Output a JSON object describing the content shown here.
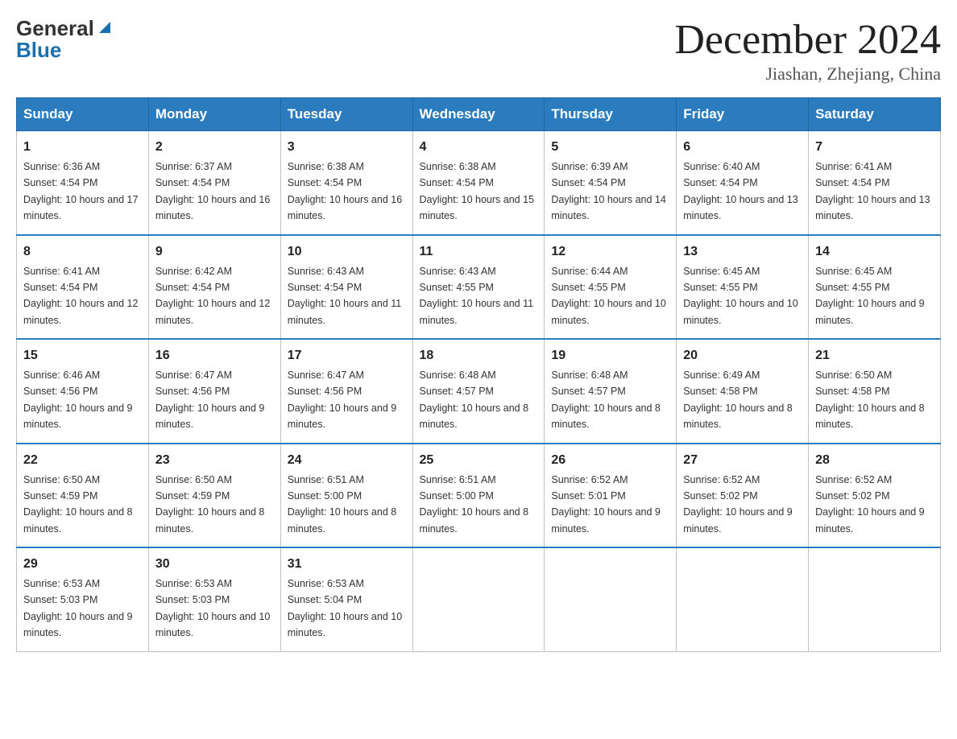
{
  "header": {
    "logo_line1": "General",
    "logo_triangle": "▶",
    "logo_line2": "Blue",
    "title": "December 2024",
    "subtitle": "Jiashan, Zhejiang, China"
  },
  "weekdays": [
    "Sunday",
    "Monday",
    "Tuesday",
    "Wednesday",
    "Thursday",
    "Friday",
    "Saturday"
  ],
  "weeks": [
    [
      {
        "day": "1",
        "sunrise": "6:36 AM",
        "sunset": "4:54 PM",
        "daylight": "10 hours and 17 minutes."
      },
      {
        "day": "2",
        "sunrise": "6:37 AM",
        "sunset": "4:54 PM",
        "daylight": "10 hours and 16 minutes."
      },
      {
        "day": "3",
        "sunrise": "6:38 AM",
        "sunset": "4:54 PM",
        "daylight": "10 hours and 16 minutes."
      },
      {
        "day": "4",
        "sunrise": "6:38 AM",
        "sunset": "4:54 PM",
        "daylight": "10 hours and 15 minutes."
      },
      {
        "day": "5",
        "sunrise": "6:39 AM",
        "sunset": "4:54 PM",
        "daylight": "10 hours and 14 minutes."
      },
      {
        "day": "6",
        "sunrise": "6:40 AM",
        "sunset": "4:54 PM",
        "daylight": "10 hours and 13 minutes."
      },
      {
        "day": "7",
        "sunrise": "6:41 AM",
        "sunset": "4:54 PM",
        "daylight": "10 hours and 13 minutes."
      }
    ],
    [
      {
        "day": "8",
        "sunrise": "6:41 AM",
        "sunset": "4:54 PM",
        "daylight": "10 hours and 12 minutes."
      },
      {
        "day": "9",
        "sunrise": "6:42 AM",
        "sunset": "4:54 PM",
        "daylight": "10 hours and 12 minutes."
      },
      {
        "day": "10",
        "sunrise": "6:43 AM",
        "sunset": "4:54 PM",
        "daylight": "10 hours and 11 minutes."
      },
      {
        "day": "11",
        "sunrise": "6:43 AM",
        "sunset": "4:55 PM",
        "daylight": "10 hours and 11 minutes."
      },
      {
        "day": "12",
        "sunrise": "6:44 AM",
        "sunset": "4:55 PM",
        "daylight": "10 hours and 10 minutes."
      },
      {
        "day": "13",
        "sunrise": "6:45 AM",
        "sunset": "4:55 PM",
        "daylight": "10 hours and 10 minutes."
      },
      {
        "day": "14",
        "sunrise": "6:45 AM",
        "sunset": "4:55 PM",
        "daylight": "10 hours and 9 minutes."
      }
    ],
    [
      {
        "day": "15",
        "sunrise": "6:46 AM",
        "sunset": "4:56 PM",
        "daylight": "10 hours and 9 minutes."
      },
      {
        "day": "16",
        "sunrise": "6:47 AM",
        "sunset": "4:56 PM",
        "daylight": "10 hours and 9 minutes."
      },
      {
        "day": "17",
        "sunrise": "6:47 AM",
        "sunset": "4:56 PM",
        "daylight": "10 hours and 9 minutes."
      },
      {
        "day": "18",
        "sunrise": "6:48 AM",
        "sunset": "4:57 PM",
        "daylight": "10 hours and 8 minutes."
      },
      {
        "day": "19",
        "sunrise": "6:48 AM",
        "sunset": "4:57 PM",
        "daylight": "10 hours and 8 minutes."
      },
      {
        "day": "20",
        "sunrise": "6:49 AM",
        "sunset": "4:58 PM",
        "daylight": "10 hours and 8 minutes."
      },
      {
        "day": "21",
        "sunrise": "6:50 AM",
        "sunset": "4:58 PM",
        "daylight": "10 hours and 8 minutes."
      }
    ],
    [
      {
        "day": "22",
        "sunrise": "6:50 AM",
        "sunset": "4:59 PM",
        "daylight": "10 hours and 8 minutes."
      },
      {
        "day": "23",
        "sunrise": "6:50 AM",
        "sunset": "4:59 PM",
        "daylight": "10 hours and 8 minutes."
      },
      {
        "day": "24",
        "sunrise": "6:51 AM",
        "sunset": "5:00 PM",
        "daylight": "10 hours and 8 minutes."
      },
      {
        "day": "25",
        "sunrise": "6:51 AM",
        "sunset": "5:00 PM",
        "daylight": "10 hours and 8 minutes."
      },
      {
        "day": "26",
        "sunrise": "6:52 AM",
        "sunset": "5:01 PM",
        "daylight": "10 hours and 9 minutes."
      },
      {
        "day": "27",
        "sunrise": "6:52 AM",
        "sunset": "5:02 PM",
        "daylight": "10 hours and 9 minutes."
      },
      {
        "day": "28",
        "sunrise": "6:52 AM",
        "sunset": "5:02 PM",
        "daylight": "10 hours and 9 minutes."
      }
    ],
    [
      {
        "day": "29",
        "sunrise": "6:53 AM",
        "sunset": "5:03 PM",
        "daylight": "10 hours and 9 minutes."
      },
      {
        "day": "30",
        "sunrise": "6:53 AM",
        "sunset": "5:03 PM",
        "daylight": "10 hours and 10 minutes."
      },
      {
        "day": "31",
        "sunrise": "6:53 AM",
        "sunset": "5:04 PM",
        "daylight": "10 hours and 10 minutes."
      },
      {
        "day": "",
        "sunrise": "",
        "sunset": "",
        "daylight": ""
      },
      {
        "day": "",
        "sunrise": "",
        "sunset": "",
        "daylight": ""
      },
      {
        "day": "",
        "sunrise": "",
        "sunset": "",
        "daylight": ""
      },
      {
        "day": "",
        "sunrise": "",
        "sunset": "",
        "daylight": ""
      }
    ]
  ]
}
